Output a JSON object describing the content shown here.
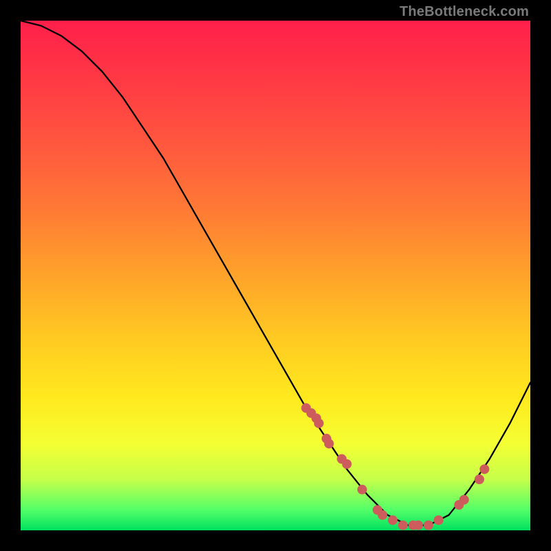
{
  "attribution": "TheBottleneck.com",
  "chart_data": {
    "type": "line",
    "title": "",
    "xlabel": "",
    "ylabel": "",
    "xlim": [
      0,
      100
    ],
    "ylim": [
      0,
      100
    ],
    "grid": false,
    "series": [
      {
        "name": "curve",
        "color": "#000000",
        "x": [
          0,
          4,
          8,
          12,
          16,
          20,
          24,
          28,
          32,
          36,
          40,
          44,
          48,
          52,
          56,
          60,
          64,
          68,
          72,
          76,
          80,
          84,
          88,
          92,
          96,
          100
        ],
        "values": [
          100,
          99,
          97,
          94,
          90,
          85,
          79,
          73,
          66,
          59,
          52,
          45,
          38,
          31,
          24,
          18,
          12,
          7,
          3,
          1,
          1,
          3,
          8,
          14,
          21,
          29
        ]
      }
    ],
    "markers": {
      "name": "points",
      "color": "#cd5c5c",
      "radius": 7,
      "x": [
        56,
        57,
        58,
        58.5,
        60,
        60.5,
        63,
        64,
        67,
        70,
        71,
        73,
        75,
        77,
        78,
        80,
        82,
        86,
        87,
        90,
        91
      ],
      "y": [
        24,
        23,
        22,
        21,
        18,
        17,
        14,
        13,
        8,
        4,
        3,
        2,
        1,
        1,
        1,
        1,
        2,
        5,
        6,
        10,
        12
      ]
    }
  }
}
